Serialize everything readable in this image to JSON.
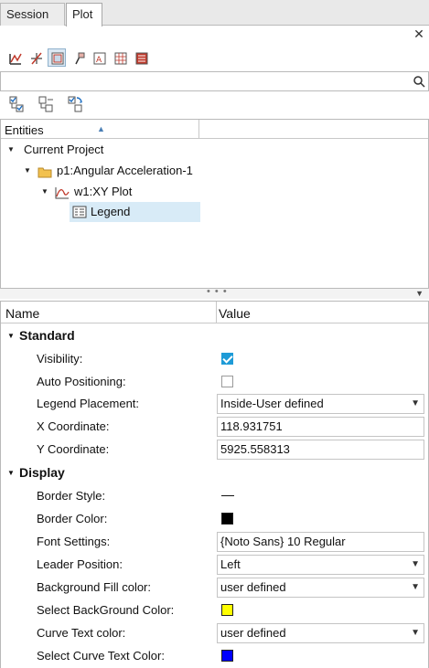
{
  "tabs": [
    {
      "label": "Session",
      "active": false
    },
    {
      "label": "Plot",
      "active": true
    }
  ],
  "toolbar_icons": [
    "plot-axes-icon",
    "crosshair-icon",
    "layout-icon",
    "pin-icon",
    "header-icon",
    "grid-icon",
    "legend-box-icon"
  ],
  "toolbar2_icons": [
    "checklist-icon",
    "list-tree-icon",
    "refresh-list-icon"
  ],
  "search": {
    "placeholder": "",
    "value": ""
  },
  "tree": {
    "header": "Entities",
    "rows": [
      {
        "label": "Current Project",
        "icon": "none"
      },
      {
        "label": "p1:Angular Acceleration-1",
        "icon": "folder-icon"
      },
      {
        "label": "w1:XY Plot",
        "icon": "xy-plot-icon"
      },
      {
        "label": "Legend",
        "icon": "legend-icon",
        "selected": true
      }
    ]
  },
  "props": {
    "header_name": "Name",
    "header_value": "Value",
    "groups": [
      {
        "label": "Standard"
      },
      {
        "label": "Display"
      }
    ],
    "visibility": {
      "label": "Visibility:",
      "checked": true
    },
    "auto_positioning": {
      "label": "Auto Positioning:",
      "checked": false
    },
    "legend_placement": {
      "label": "Legend Placement:",
      "value": "Inside-User defined"
    },
    "x_coordinate": {
      "label": "X Coordinate:",
      "value": "118.931751"
    },
    "y_coordinate": {
      "label": "Y Coordinate:",
      "value": "5925.558313"
    },
    "border_style": {
      "label": "Border Style:"
    },
    "border_color": {
      "label": "Border Color:",
      "color": "#000000"
    },
    "font_settings": {
      "label": "Font Settings:",
      "value": "{Noto Sans} 10 Regular"
    },
    "leader_position": {
      "label": "Leader Position:",
      "value": "Left"
    },
    "background_fill": {
      "label": "Background Fill color:",
      "value": "user defined"
    },
    "select_background": {
      "label": "Select BackGround Color:",
      "color": "#ffff00"
    },
    "curve_text_color": {
      "label": "Curve Text color:",
      "value": "user defined"
    },
    "select_curve_text": {
      "label": "Select Curve Text Color:",
      "color": "#0000ff"
    }
  },
  "colors": {
    "accent": "#1e9bd7",
    "selection": "#d8ebf7"
  }
}
